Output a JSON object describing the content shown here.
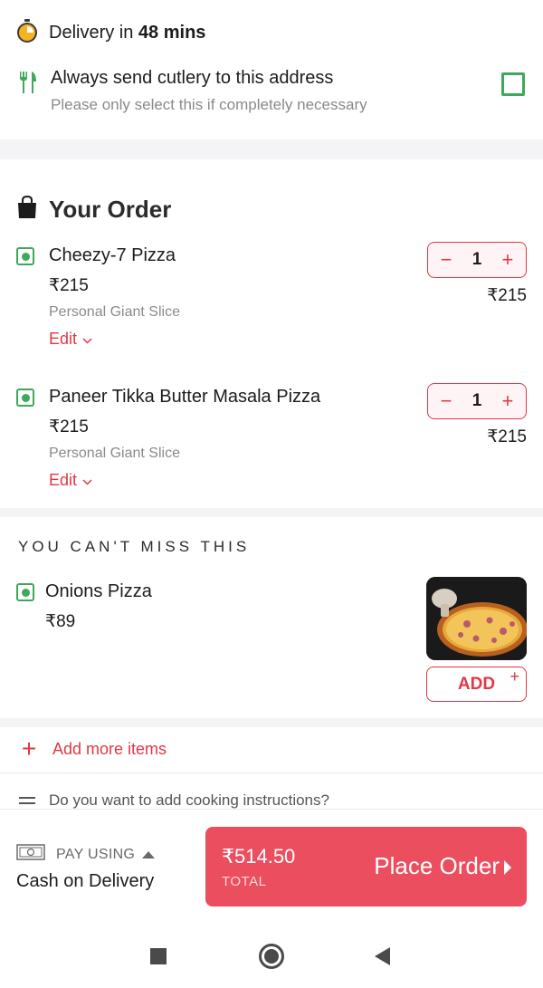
{
  "delivery": {
    "prefix": "Delivery in ",
    "time": "48 mins"
  },
  "cutlery": {
    "title": "Always send cutlery to this address",
    "subtitle": "Please only select this if completely necessary",
    "checked": false
  },
  "order": {
    "title": "Your Order",
    "items": [
      {
        "name": "Cheezy-7 Pizza",
        "price": "₹215",
        "description": "Personal Giant Slice",
        "edit_label": "Edit",
        "quantity": "1",
        "line_total": "₹215",
        "veg": true
      },
      {
        "name": "Paneer Tikka Butter Masala Pizza",
        "price": "₹215",
        "description": "Personal Giant Slice",
        "edit_label": "Edit",
        "quantity": "1",
        "line_total": "₹215",
        "veg": true
      }
    ]
  },
  "upsell": {
    "title": "YOU CAN'T MISS THIS",
    "item": {
      "name": "Onions Pizza",
      "price": "₹89",
      "add_label": "ADD",
      "add_plus": "+",
      "veg": true
    }
  },
  "add_more": {
    "label": "Add more items",
    "icon": "+"
  },
  "cooking": {
    "label": "Do you want to add cooking instructions?"
  },
  "payment": {
    "pay_using_label": "PAY USING",
    "method": "Cash on Delivery"
  },
  "checkout": {
    "total_amount": "₹514.50",
    "total_label": "TOTAL",
    "place_order_label": "Place Order"
  },
  "stepper": {
    "minus": "−",
    "plus": "+"
  },
  "colors": {
    "accent": "#e23744",
    "button": "#eb4e5e",
    "veg": "#3ea85b"
  }
}
